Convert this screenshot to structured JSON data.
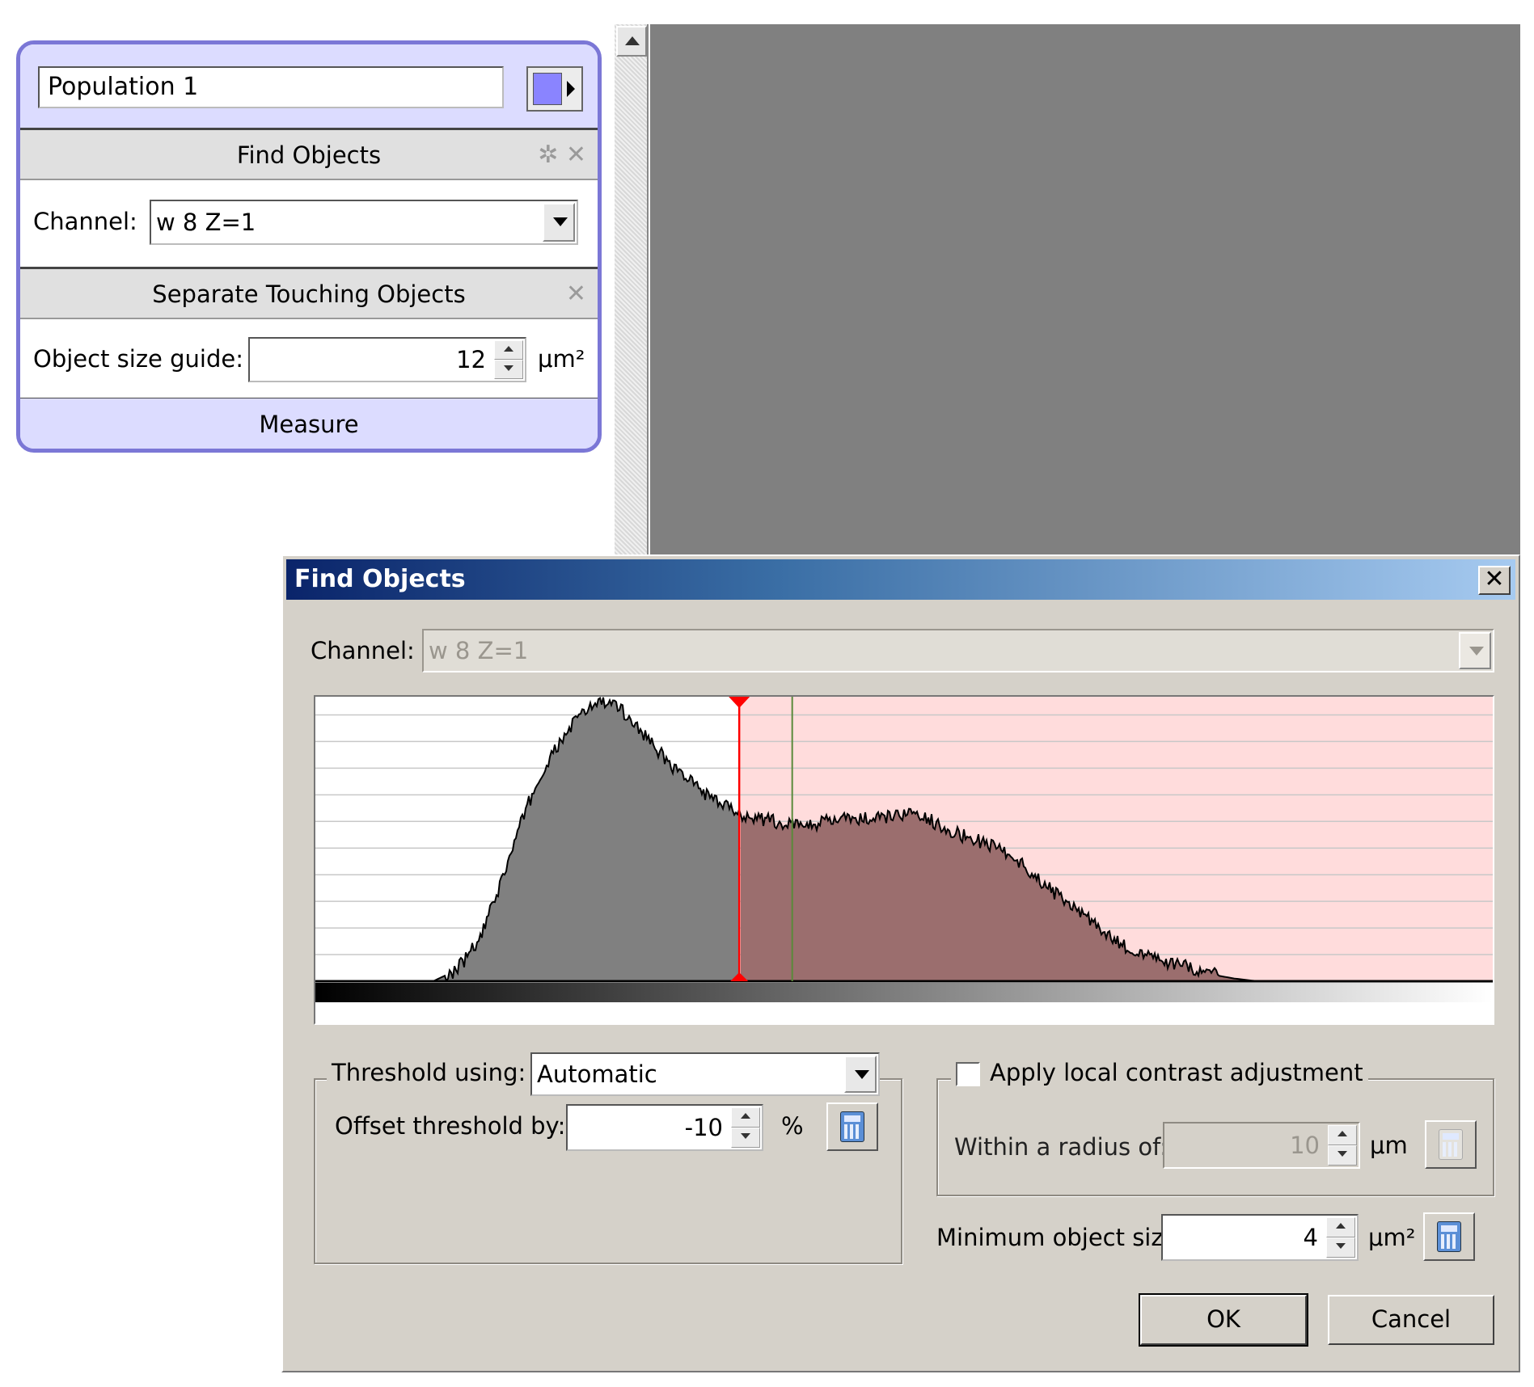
{
  "pipeline": {
    "population_name": "Population 1",
    "population_color": "#8a84ff",
    "find_objects": {
      "title": "Find Objects",
      "icons": [
        "gear-icon",
        "close-icon"
      ],
      "channel_label": "Channel:",
      "channel_value": "w 8 Z=1"
    },
    "separate": {
      "title": "Separate Touching Objects",
      "icons": [
        "close-icon"
      ],
      "size_label": "Object size guide:",
      "size_value": "12",
      "size_unit": "μm²"
    },
    "measure_label": "Measure"
  },
  "viewer": {
    "background": "#808080"
  },
  "dialog": {
    "title": "Find Objects",
    "close_glyph": "✕",
    "channel_label": "Channel:",
    "channel_value": "w 8 Z=1",
    "threshold": {
      "using_label": "Threshold using:",
      "using_value": "Automatic",
      "offset_label": "Offset threshold by:",
      "offset_value": "-10",
      "offset_unit": "%"
    },
    "local_contrast": {
      "checkbox_label": "Apply local contrast adjustment",
      "checked": false,
      "radius_label": "Within a radius of:",
      "radius_value": "10",
      "radius_unit": "μm"
    },
    "min_size": {
      "label": "Minimum object size:",
      "value": "4",
      "unit": "μm²"
    },
    "ok_label": "OK",
    "cancel_label": "Cancel"
  },
  "chart_data": {
    "type": "area",
    "x_range": [
      0,
      1
    ],
    "y_range": [
      0,
      1
    ],
    "grid": true,
    "threshold_x": 0.36,
    "marker_x": 0.405,
    "thresholded_region_color": "#ffdcdc",
    "histogram_fill": "#808080",
    "thresholded_fill": "#9b6e6e",
    "threshold_line_color": "#ff0000",
    "marker_line_color": "#5a8a3a",
    "x": [
      0.0,
      0.05,
      0.08,
      0.1,
      0.12,
      0.14,
      0.16,
      0.18,
      0.2,
      0.22,
      0.24,
      0.25,
      0.26,
      0.28,
      0.3,
      0.32,
      0.34,
      0.36,
      0.38,
      0.4,
      0.42,
      0.45,
      0.48,
      0.5,
      0.52,
      0.55,
      0.58,
      0.6,
      0.62,
      0.64,
      0.66,
      0.68,
      0.7,
      0.72,
      0.74,
      0.76,
      0.78,
      0.8,
      0.82,
      0.85,
      0.9,
      1.0
    ],
    "y": [
      0.0,
      0.0,
      0.0,
      0.0,
      0.04,
      0.15,
      0.38,
      0.63,
      0.8,
      0.93,
      1.0,
      0.99,
      0.97,
      0.88,
      0.78,
      0.71,
      0.64,
      0.6,
      0.58,
      0.56,
      0.56,
      0.58,
      0.58,
      0.6,
      0.58,
      0.52,
      0.48,
      0.42,
      0.34,
      0.28,
      0.21,
      0.14,
      0.1,
      0.07,
      0.05,
      0.025,
      0.01,
      0.0,
      0.0,
      0.0,
      0.0,
      0.0
    ]
  }
}
